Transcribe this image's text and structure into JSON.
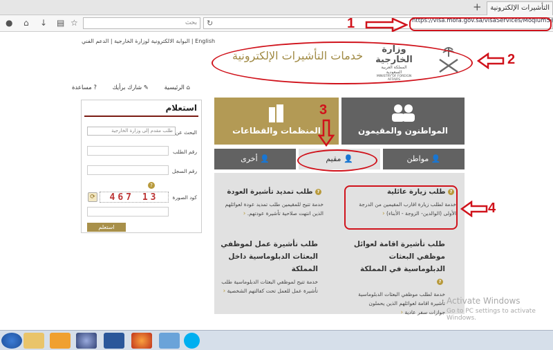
{
  "browser": {
    "tab_title": "التأشيرات الإلكترونية",
    "new_tab": "+",
    "close_tab": "×",
    "search_placeholder": "بحث",
    "url": "https://visa.mofa.gov.sa/visaServices/MoqiumServices"
  },
  "header": {
    "links": "البوابة الالكترونية لوزارة الخارجية | الدعم الفني | English",
    "title": "خدمات التأشيرات الإلكترونية",
    "ministry_ar": "وزارة الخارجية",
    "ministry_kingdom": "المملكة العربية السعودية",
    "ministry_en": "MINISTRY OF FOREIGN AFFAIRS"
  },
  "nav": {
    "home": "الرئيسية",
    "share": "شارك برأيك",
    "help": "مساعدة"
  },
  "inquiry": {
    "title": "استعلام",
    "search_by_label": "البحث عن",
    "search_by_value": "طلب مقدم إلى وزارة الخارجية",
    "request_no_label": "رقم الطلب",
    "record_no_label": "رقم السجل",
    "captcha_label": "كود الصورة",
    "captcha_text": "467 13",
    "submit": "استعلم"
  },
  "categories": {
    "citizens": "المواطنون والمقيمون",
    "orgs": "المنظمات والقطاعات"
  },
  "subtabs": {
    "citizen": "مواطن",
    "resident": "مقيم",
    "other": "أخرى"
  },
  "services": {
    "family_visit_title": "طلب زيارة عائلية",
    "family_visit_desc": "خدمة لطلب زيارة اقارب المقيمين من الدرجة الأولى (الوالدين- الزوجة - الأبناء)",
    "reentry_title": "طلب تمديد تأشيرة العودة",
    "reentry_desc": "خدمة تتيح للمقيمين طلب تمديد عودة لعوائلهم الذين انتهت صلاحية تأشيرة عودتهم.",
    "dip_family_title": "طلب تأشيرة اقامة لعوائل موظفي البعثات الدبلوماسية في المملكة",
    "dip_family_desc": "خدمة لطلب موظفي البعثات الدبلوماسية تأشيرة اقامة لعوائلهم الذين يحملون جوازات سفر عادية",
    "dip_work_title": "طلب تأشيرة عمل لموظفي البعثات الدبلوماسية داخل المملكة",
    "dip_work_desc": "خدمة تتيح لموظفي البعثات الدبلوماسية طلب تأشيرة عمل للعمل تحت كفالتهم الشخصية"
  },
  "annotations": {
    "n1": "1",
    "n2": "2",
    "n3": "3",
    "n4": "4"
  },
  "watermark": {
    "line1": "Activate Windows",
    "line2": "Go to PC settings to activate Windows."
  },
  "colors": {
    "gold": "#b39a55",
    "dark_gray": "#626262",
    "annotation_red": "#d0121b"
  }
}
